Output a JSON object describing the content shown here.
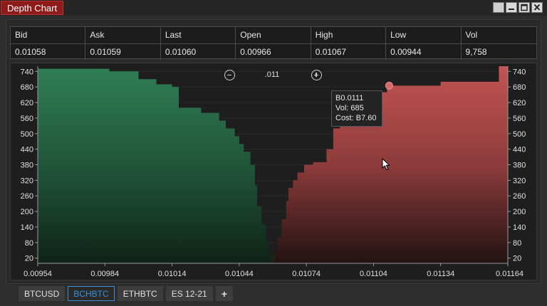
{
  "window": {
    "title": "Depth Chart"
  },
  "stats": {
    "headers": [
      "Bid",
      "Ask",
      "Last",
      "Open",
      "High",
      "Low",
      "Vol"
    ],
    "values": [
      "0.01058",
      "0.01059",
      "0.01060",
      "0.00966",
      "0.01067",
      "0.00944",
      "9,758"
    ]
  },
  "zoom": {
    "value": ".011"
  },
  "tooltip": {
    "price": "B0.0111",
    "vol": "Vol: 685",
    "cost": "Cost: B7.60"
  },
  "tabs": [
    "BTCUSD",
    "BCHBTC",
    "ETHBTC",
    "ES 12-21"
  ],
  "active_tab": "BCHBTC",
  "add_tab_label": "+",
  "colors": {
    "bid": "#2e7b52",
    "ask": "#c25454",
    "accent": "#3b8fd6",
    "title_bg": "#8f1a1a"
  },
  "chart_data": {
    "type": "area",
    "x_ticks": [
      "0.00954",
      "0.00984",
      "0.01014",
      "0.01044",
      "0.01074",
      "0.01104",
      "0.01134",
      "0.01164"
    ],
    "y_ticks": [
      "740",
      "680",
      "620",
      "560",
      "500",
      "440",
      "380",
      "320",
      "260",
      "200",
      "140",
      "80",
      "20"
    ],
    "xlim": [
      0.00954,
      0.01164
    ],
    "ylim": [
      0,
      760
    ],
    "series": [
      {
        "side": "bid",
        "x": [
          0.00954,
          0.00986,
          0.00999,
          0.01007,
          0.01014,
          0.01017,
          0.01027,
          0.01035,
          0.01038,
          0.01042,
          0.01044,
          0.01046,
          0.01049,
          0.01051,
          0.01052,
          0.01054,
          0.01056,
          0.01057,
          0.01058
        ],
        "y": [
          750,
          740,
          710,
          690,
          680,
          600,
          580,
          550,
          520,
          490,
          460,
          430,
          380,
          300,
          220,
          150,
          80,
          40,
          0
        ]
      },
      {
        "side": "ask",
        "x": [
          0.01059,
          0.0106,
          0.01061,
          0.01063,
          0.01065,
          0.01066,
          0.01068,
          0.0107,
          0.01073,
          0.01077,
          0.01083,
          0.01086,
          0.01089,
          0.01093,
          0.01096,
          0.011,
          0.0111,
          0.01111,
          0.01134,
          0.0116,
          0.01164
        ],
        "y": [
          0,
          40,
          100,
          170,
          240,
          290,
          320,
          350,
          380,
          390,
          440,
          520,
          590,
          610,
          640,
          660,
          675,
          685,
          700,
          760,
          760
        ]
      }
    ],
    "highlight": {
      "x": 0.01111,
      "y": 685
    }
  }
}
